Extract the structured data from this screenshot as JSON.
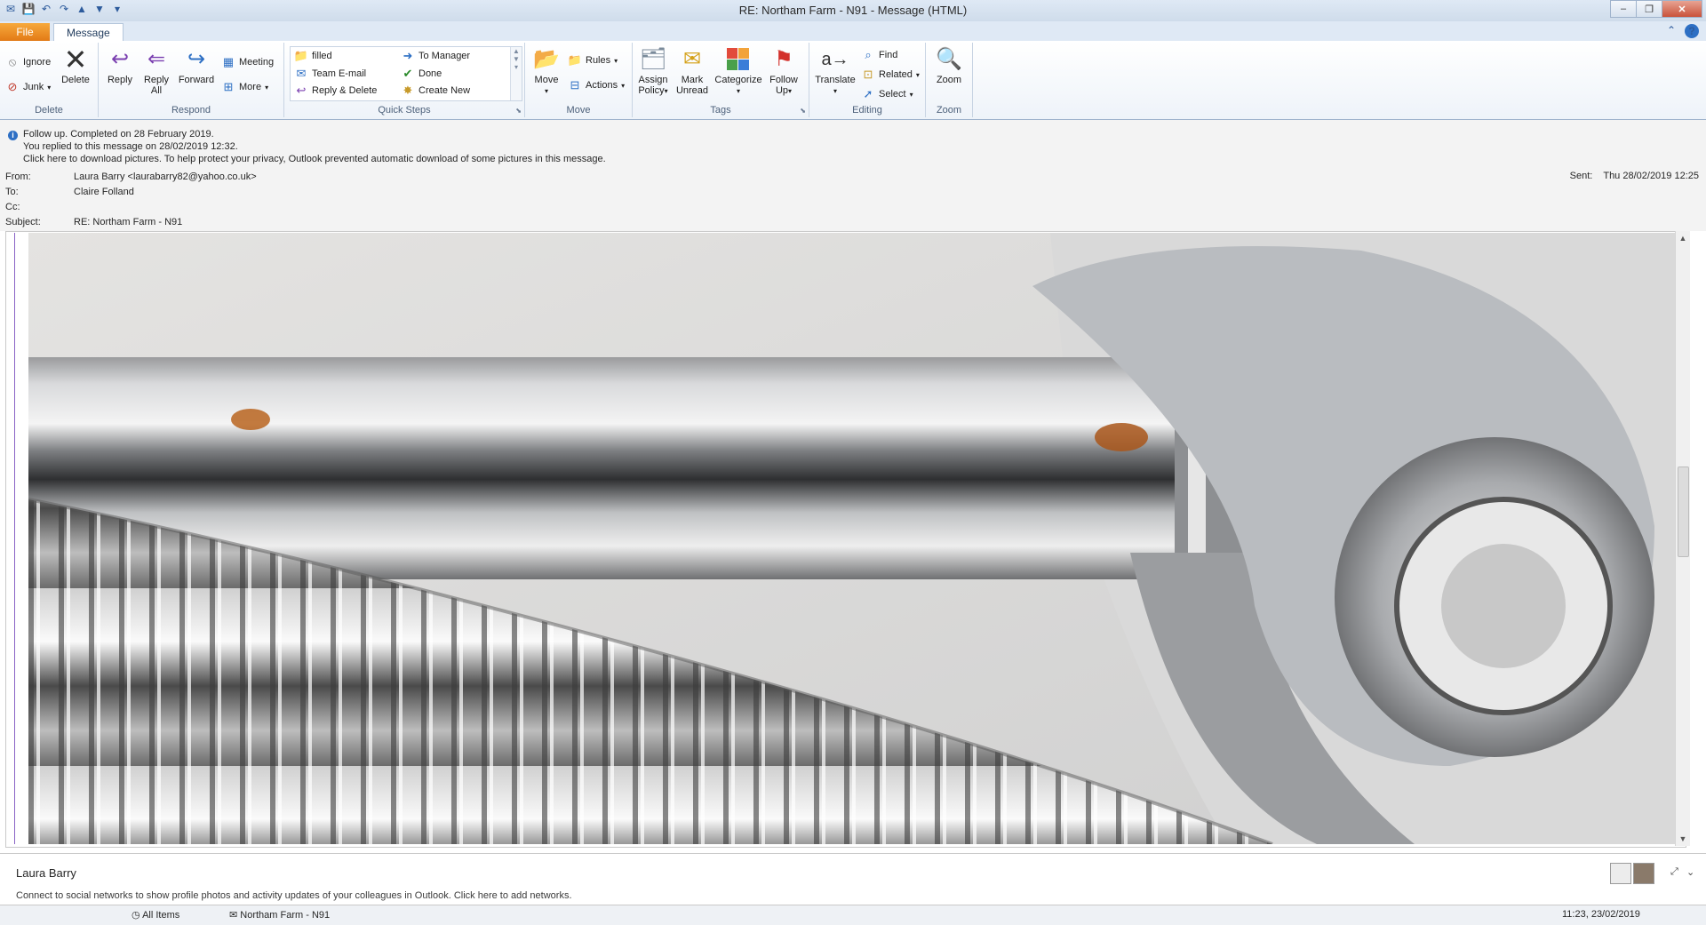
{
  "window": {
    "title": "RE: Northam Farm - N91  -  Message (HTML)",
    "controls": {
      "minimize": "–",
      "restore": "❐",
      "close": "✕"
    }
  },
  "tabs": {
    "file": "File",
    "message": "Message"
  },
  "ribbon": {
    "delete_group": {
      "label": "Delete",
      "ignore": "Ignore",
      "junk": "Junk",
      "delete": "Delete"
    },
    "respond_group": {
      "label": "Respond",
      "reply": "Reply",
      "reply_all_1": "Reply",
      "reply_all_2": "All",
      "forward": "Forward",
      "meeting": "Meeting",
      "more": "More"
    },
    "quicksteps_group": {
      "label": "Quick Steps",
      "items": [
        "filled",
        "Team E-mail",
        "Reply & Delete",
        "To Manager",
        "Done",
        "Create New"
      ]
    },
    "move_group": {
      "label": "Move",
      "move": "Move",
      "rules": "Rules",
      "actions": "Actions"
    },
    "tags_group": {
      "label": "Tags",
      "assign_1": "Assign",
      "assign_2": "Policy",
      "mark_1": "Mark",
      "mark_2": "Unread",
      "categorize": "Categorize",
      "follow_1": "Follow",
      "follow_2": "Up"
    },
    "editing_group": {
      "label": "Editing",
      "translate": "Translate",
      "find": "Find",
      "related": "Related",
      "select": "Select"
    },
    "zoom_group": {
      "label": "Zoom",
      "zoom": "Zoom"
    }
  },
  "infobar": {
    "line1": "Follow up.  Completed on 28 February 2019.",
    "line2": "You replied to this message on 28/02/2019 12:32.",
    "line3": "Click here to download pictures. To help protect your privacy, Outlook prevented automatic download of some pictures in this message."
  },
  "header": {
    "from_label": "From:",
    "from_value": "Laura Barry <laurabarry82@yahoo.co.uk>",
    "to_label": "To:",
    "to_value": "Claire Folland",
    "cc_label": "Cc:",
    "subject_label": "Subject:",
    "subject_value": "RE: Northam Farm - N91",
    "sent_label": "Sent:",
    "sent_value": "Thu 28/02/2019 12:25"
  },
  "people_pane": {
    "name": "Laura Barry",
    "social": "Connect to social networks to show profile photos and activity updates of your colleagues in Outlook. Click here to add networks."
  },
  "statusbar": {
    "all_items": "All Items",
    "item": "Northam Farm - N91",
    "time": "11:23, 23/02/2019"
  },
  "colors": {
    "accent": "#2d6fc4",
    "file_tab": "#e27a16",
    "rust": "#b8641e",
    "chrome": "#b9bcc0"
  }
}
